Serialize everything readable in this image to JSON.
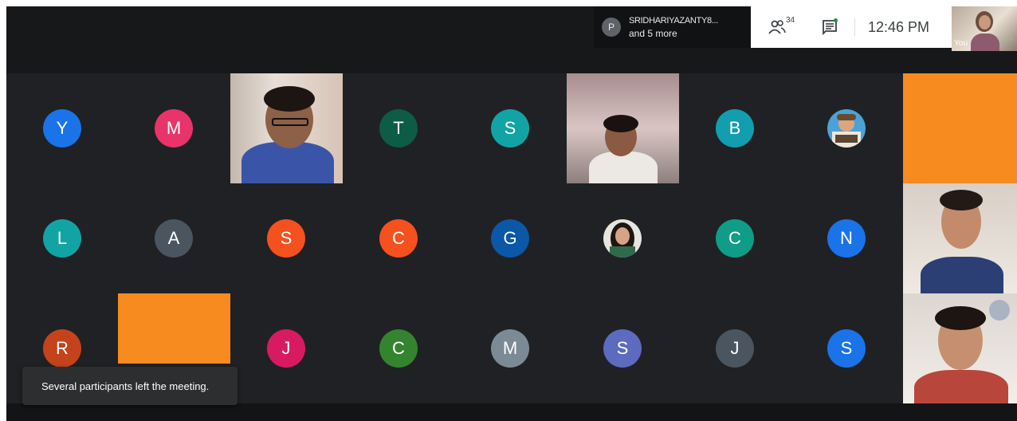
{
  "presenting": {
    "avatar_letter": "P",
    "name": "SRIDHARIYAZANTY8...",
    "others": "and 5 more"
  },
  "info": {
    "participant_count": "34",
    "time": "12:46 PM"
  },
  "self_view": {
    "label": "You",
    "more": "⋯"
  },
  "participants": [
    {
      "letter": "Y",
      "color": "#1a73e8"
    },
    {
      "letter": "M",
      "color": "#e8336b"
    },
    {
      "letter": "T",
      "color": "#0d5c46"
    },
    {
      "letter": "S",
      "color": "#12a4a4"
    },
    {
      "letter": "B",
      "color": "#129eaf"
    },
    {
      "letter": "L",
      "color": "#12a4a4"
    },
    {
      "letter": "A",
      "color": "#4a5560"
    },
    {
      "letter": "S",
      "color": "#f4511e"
    },
    {
      "letter": "C",
      "color": "#f4511e"
    },
    {
      "letter": "G",
      "color": "#0b57a8"
    },
    {
      "letter": "C",
      "color": "#0f9d88"
    },
    {
      "letter": "N",
      "color": "#1a73e8"
    },
    {
      "letter": "R",
      "color": "#c5431a"
    },
    {
      "letter": "J",
      "color": "#d81b60"
    },
    {
      "letter": "C",
      "color": "#34842f"
    },
    {
      "letter": "M",
      "color": "#7c8a96"
    },
    {
      "letter": "S",
      "color": "#5c6bc0"
    },
    {
      "letter": "J",
      "color": "#4a5560"
    },
    {
      "letter": "S",
      "color": "#1a73e8"
    }
  ],
  "toast": {
    "message": "Several participants left the meeting."
  },
  "colors": {
    "orange_tile": "#f78b1f",
    "background": "#202124"
  }
}
